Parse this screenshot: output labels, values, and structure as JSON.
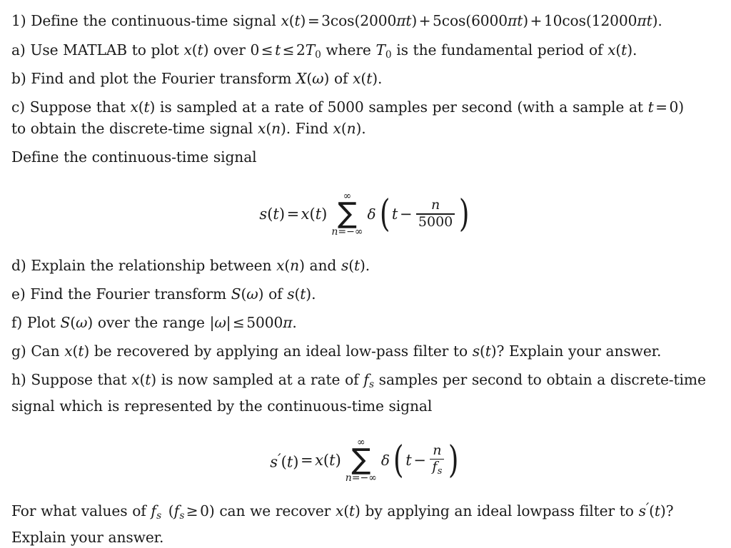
{
  "document": {
    "type": "problem-sheet",
    "background_color": "#ffffff",
    "text_color": "#1a1a1a"
  },
  "problem": {
    "number": "1)",
    "intro": {
      "label": "1)",
      "text_before": "Define the continuous-time signal",
      "equation": "x(t) = 3cos(2000πt) + 5cos(6000πt) + 10cos(12000πt).",
      "signal_name": "x(t)",
      "terms": [
        {
          "amplitude": "3",
          "function": "cos",
          "argument": "2000πt"
        },
        {
          "amplitude": "5",
          "function": "cos",
          "argument": "6000πt"
        },
        {
          "amplitude": "10",
          "function": "cos",
          "argument": "12000πt"
        }
      ]
    },
    "parts": [
      {
        "label": "a)",
        "text": "Use MATLAB to plot x(t) over 0 ≤ t ≤ 2T₀ where T₀ is the fundamental period of x(t).",
        "segments": [
          "Use MATLAB to plot ",
          "x(t)",
          " over ",
          "0 ≤ t ≤ 2T",
          "0",
          " where ",
          "T",
          "0",
          " is the fundamental period of ",
          "x(t)",
          "."
        ]
      },
      {
        "label": "b)",
        "text": "Find and plot the Fourier transform X(ω) of x(t)."
      },
      {
        "label": "c)",
        "text": "Suppose that x(t) is sampled at a rate of 5000 samples per second (with a sample at t = 0) to obtain the discrete-time signal x(n). Find x(n).",
        "sample_rate": "5000",
        "sample_rate_unit": "samples per second",
        "sample_at": "t = 0"
      },
      {
        "label": "d)",
        "text": "Explain the relationship between x(n) and s(t)."
      },
      {
        "label": "e)",
        "text": "Find the Fourier transform S(ω) of s(t)."
      },
      {
        "label": "f)",
        "text": "Plot S(ω) over the range |ω| ≤ 5000π.",
        "range_bound": "5000π"
      },
      {
        "label": "g)",
        "text": "Can x(t) be recovered by applying an ideal low-pass filter to s(t)? Explain your answer."
      },
      {
        "label": "h)",
        "text": "Suppose that x(t) is now sampled at a rate of fₛ samples per second to obtain a discrete-time signal which is represented by the continuous-time signal",
        "sample_rate_symbol": "fₛ"
      }
    ],
    "define_line": "Define the continuous-time signal",
    "closing": {
      "line1": "For what values of fₛ  (fₛ ≥ 0) can we recover x(t) by applying an ideal lowpass filter to s′(t)?",
      "line2": "Explain your answer."
    },
    "equations": [
      {
        "id": "eq-s-of-t",
        "latex": "s(t) = x(t) \\sum_{n=-\\infty}^{\\infty} \\delta\\left(t - \\frac{n}{5000}\\right)",
        "lhs": "s(t)",
        "rhs_factor": "x(t)",
        "sum_lower": "n=−∞",
        "sum_upper": "∞",
        "delta_arg_var": "t",
        "numerator": "n",
        "denominator": "5000"
      },
      {
        "id": "eq-s-prime-of-t",
        "latex": "s'(t) = x(t) \\sum_{n=-\\infty}^{\\infty} \\delta\\left(t - \\frac{n}{f_s}\\right)",
        "lhs": "s′(t)",
        "rhs_factor": "x(t)",
        "sum_lower": "n=−∞",
        "sum_upper": "∞",
        "delta_arg_var": "t",
        "numerator": "n",
        "denominator": "fₛ"
      }
    ]
  },
  "symbols": {
    "sum": "∑",
    "infinity": "∞",
    "delta": "δ",
    "omega": "ω",
    "pi": "π",
    "leq": "≤",
    "geq": "≥",
    "minus": "−",
    "equals": "=",
    "plus": "+"
  }
}
